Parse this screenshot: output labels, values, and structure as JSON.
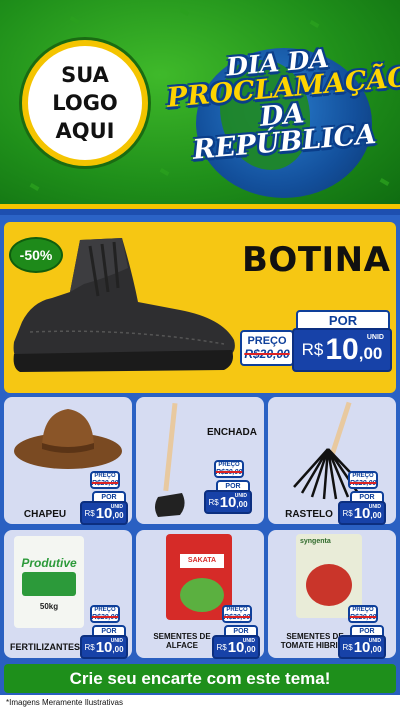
{
  "header": {
    "logo_text": "SUA\nLOGO\nAQUI",
    "title_line1": "DIA DA",
    "title_line2": "PROCLAMAÇÃO",
    "title_line3": "DA REPÚBLICA"
  },
  "featured": {
    "discount": "-50%",
    "name": "BOTINA",
    "old_label": "PREÇO",
    "old_price": "R$20,00",
    "por_label": "POR",
    "new_currency": "R$",
    "new_main": "10",
    "new_cents": ",00",
    "unit": "UNID"
  },
  "products": [
    {
      "name": "CHAPEU",
      "old_label": "PREÇO",
      "old_price": "R$20,00",
      "por_label": "POR",
      "new_currency": "R$",
      "new_main": "10",
      "new_cents": ",00",
      "unit": "UNID"
    },
    {
      "name": "ENCHADA",
      "old_label": "PREÇO",
      "old_price": "R$20,00",
      "por_label": "POR",
      "new_currency": "R$",
      "new_main": "10",
      "new_cents": ",00",
      "unit": "UNID"
    },
    {
      "name": "RASTELO",
      "old_label": "PREÇO",
      "old_price": "R$20,00",
      "por_label": "POR",
      "new_currency": "R$",
      "new_main": "10",
      "new_cents": ",00",
      "unit": "UNID"
    },
    {
      "name": "FERTILIZANTES",
      "brand": "Produtive",
      "weight": "50kg",
      "old_label": "PREÇO",
      "old_price": "R$20,00",
      "por_label": "POR",
      "new_currency": "R$",
      "new_main": "10",
      "new_cents": ",00",
      "unit": "UNID"
    },
    {
      "name": "SEMENTES DE\nALFACE",
      "brand": "SAKATA",
      "old_label": "PREÇO",
      "old_price": "R$20,00",
      "por_label": "POR",
      "new_currency": "R$",
      "new_main": "10",
      "new_cents": ",00",
      "unit": "UNID"
    },
    {
      "name": "SEMENTES DE\nTOMATE HIBRIDA",
      "brand": "syngenta",
      "old_label": "PREÇO",
      "old_price": "R$20,00",
      "por_label": "POR",
      "new_currency": "R$",
      "new_main": "10",
      "new_cents": ",00",
      "unit": "UNID"
    }
  ],
  "cta": "Crie seu encarte com este tema!",
  "footer_note": "*Imagens Meramente Ilustrativas",
  "colors": {
    "green": "#1e8f1b",
    "yellow": "#f6c713",
    "blue": "#1742a8",
    "tile": "#d6dcf2"
  }
}
